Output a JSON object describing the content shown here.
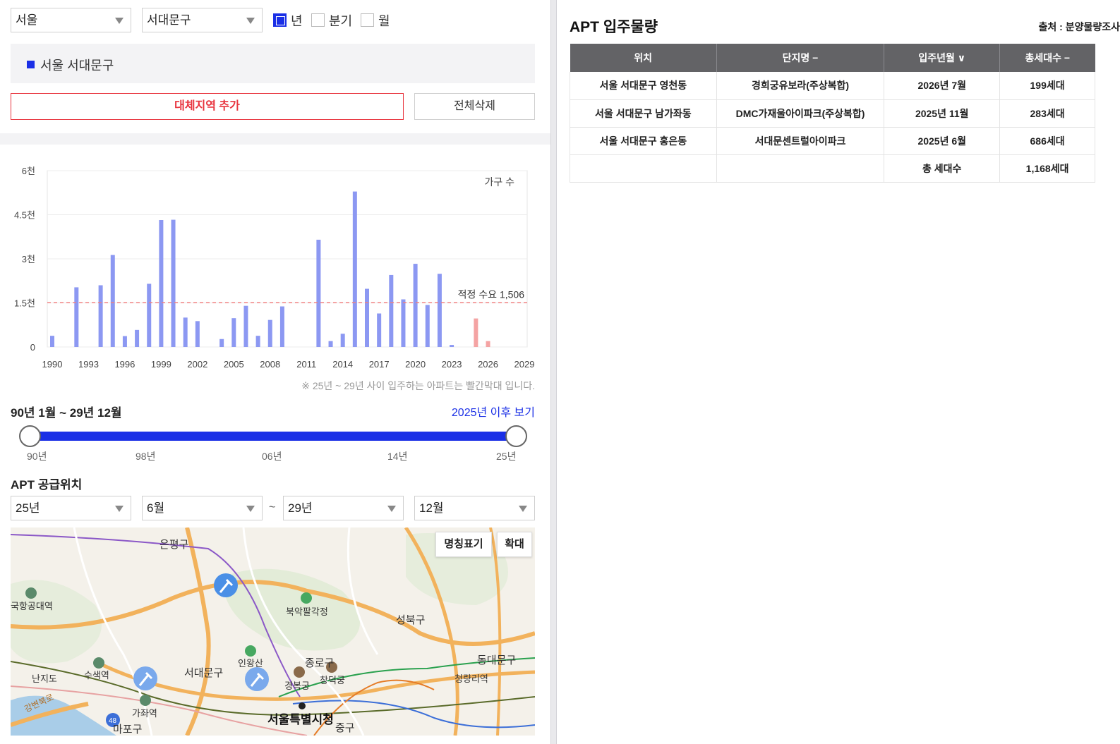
{
  "filters": {
    "city": "서울",
    "district": "서대문구",
    "period_options": [
      {
        "label": "년",
        "checked": true
      },
      {
        "label": "분기",
        "checked": false
      },
      {
        "label": "월",
        "checked": false
      }
    ]
  },
  "selected_region": "서울 서대문구",
  "buttons": {
    "add_region": "대체지역 추가",
    "delete_all": "전체삭제"
  },
  "chart_data": {
    "type": "bar",
    "series_label": "가구 수",
    "reference_label": "적정 수요 1,506",
    "reference_value": 1506,
    "y_ticks": [
      "0",
      "1.5천",
      "3천",
      "4.5천",
      "6천"
    ],
    "ylim": [
      0,
      6000
    ],
    "x_ticks": [
      "1990",
      "1993",
      "1996",
      "1999",
      "2002",
      "2005",
      "2008",
      "2011",
      "2014",
      "2017",
      "2020",
      "2023",
      "2026",
      "2029"
    ],
    "x": [
      1990,
      1991,
      1992,
      1993,
      1994,
      1995,
      1996,
      1997,
      1998,
      1999,
      2000,
      2001,
      2002,
      2003,
      2004,
      2005,
      2006,
      2007,
      2008,
      2009,
      2010,
      2011,
      2012,
      2013,
      2014,
      2015,
      2016,
      2017,
      2018,
      2019,
      2020,
      2021,
      2022,
      2023,
      2024,
      2025,
      2026,
      2027,
      2028,
      2029
    ],
    "values": [
      380,
      0,
      2030,
      0,
      2100,
      3130,
      370,
      580,
      2150,
      4320,
      4330,
      1000,
      880,
      0,
      270,
      980,
      1400,
      380,
      920,
      1380,
      0,
      0,
      3650,
      200,
      450,
      5290,
      1980,
      1140,
      2450,
      1620,
      2830,
      1430,
      2490,
      70,
      0,
      970,
      200,
      0,
      0,
      0
    ],
    "future_from": 2025,
    "colors": {
      "past": "#8c98f2",
      "future": "#f4a3a3",
      "reference": "#f08080"
    }
  },
  "chart_note": "※ 25년 ~ 29년 사이 입주하는 아파트는 빨간막대 입니다.",
  "range": {
    "title": "90년 1월 ~ 29년 12월",
    "after_link": "2025년 이후 보기",
    "ticks": [
      "90년",
      "98년",
      "06년",
      "14년",
      "25년"
    ]
  },
  "supply": {
    "title": "APT 공급위치",
    "from_year": "25년",
    "from_month": "6월",
    "tilde": "~",
    "to_year": "29년",
    "to_month": "12월"
  },
  "map": {
    "buttons": {
      "labels": "명칭표기",
      "zoom": "확대"
    },
    "places": [
      "은평구",
      "북악팔각정",
      "성북구",
      "국항공대역",
      "인왕산",
      "종로구",
      "서대문구",
      "동대문구",
      "수색역",
      "난지도",
      "경복궁",
      "창덕궁",
      "청량리역",
      "가좌역",
      "서울특별시청",
      "마포구",
      "중구",
      "강변북로",
      "48"
    ]
  },
  "table": {
    "title": "APT 입주물량",
    "source": "출처 : 분양물량조사",
    "headers": [
      "위치",
      "단지명 −",
      "입주년월 ∨",
      "총세대수 −"
    ],
    "rows": [
      [
        "서울 서대문구 영천동",
        "경희궁유보라(주상복합)",
        "2026년 7월",
        "199세대"
      ],
      [
        "서울 서대문구 남가좌동",
        "DMC가재울아이파크(주상복합)",
        "2025년 11월",
        "283세대"
      ],
      [
        "서울 서대문구 홍은동",
        "서대문센트럴아이파크",
        "2025년 6월",
        "686세대"
      ]
    ],
    "total_label": "총 세대수",
    "total_value": "1,168세대"
  }
}
